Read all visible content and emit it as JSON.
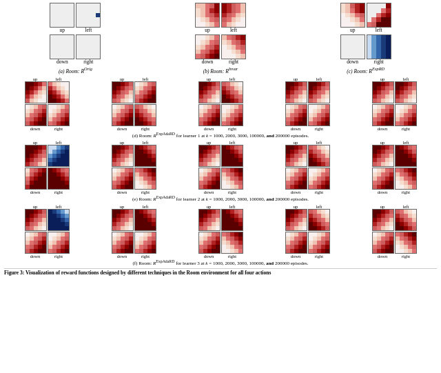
{
  "title": "Figure 3: Visualization of reward functions designed by different techniques in the Room environment for all four actions",
  "sections": {
    "top_row": {
      "items": [
        {
          "label": "(a) Room: R^Orig",
          "direction_labels": {
            "ul": "up",
            "ur": "left",
            "dl": "down",
            "dr": "right"
          }
        },
        {
          "label": "(b) Room: R^Invar",
          "direction_labels": {
            "ul": "up",
            "ur": "left",
            "dl": "down",
            "dr": "right"
          }
        },
        {
          "label": "(c) Room: R^ExpRD",
          "direction_labels": {
            "ul": "up",
            "ur": "left",
            "dl": "down",
            "dr": "right"
          }
        }
      ]
    },
    "learner_rows": [
      {
        "label": "(d) Room: R^ExpAdaRD for learner 1 at k = 1000, 2000, 3000, 100000, and 200000 episodes."
      },
      {
        "label": "(e) Room: R^ExpAdaRD for learner 2 at k = 1000, 2000, 3000, 100000, and 200000 episodes."
      },
      {
        "label": "(f) Room: R^ExpAdaRD for learner 3 at k = 1000, 2000, 3000, 100000, and 200000 episodes."
      }
    ],
    "direction_labels": {
      "up": "up",
      "left": "left",
      "down": "down",
      "right": "right"
    }
  }
}
